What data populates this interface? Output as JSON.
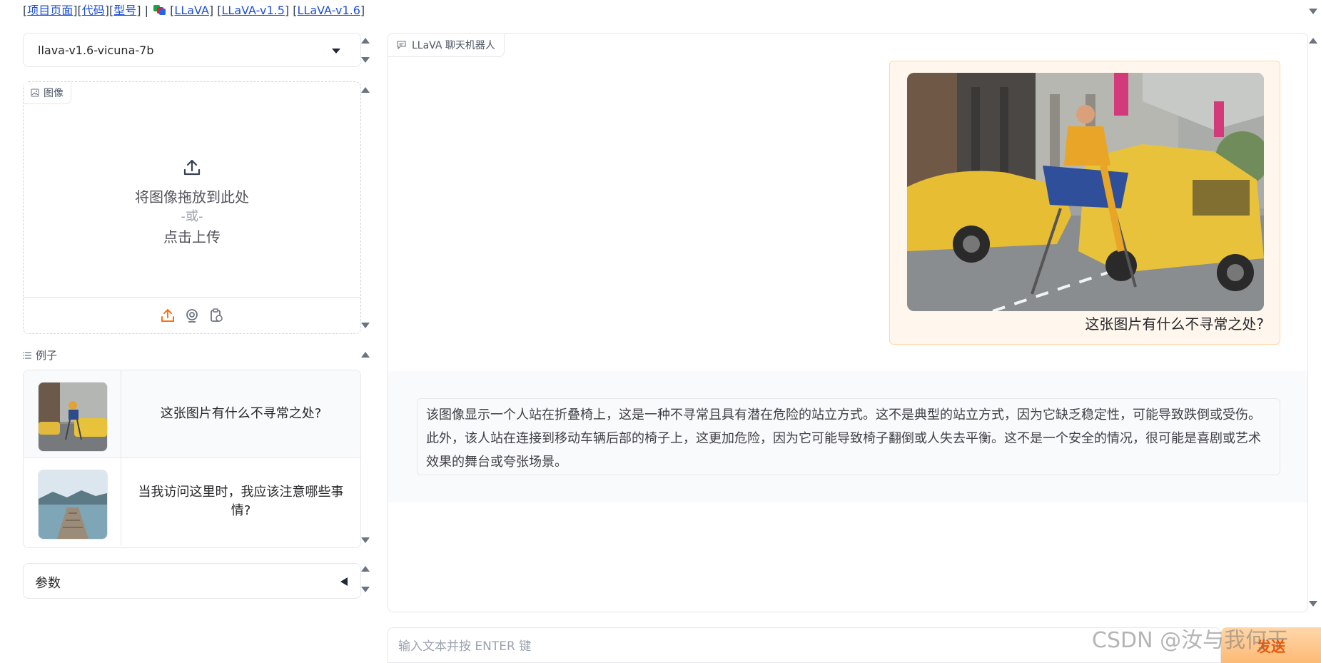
{
  "top_links": {
    "project_page": "项目页面",
    "code": "代码",
    "model": "型号",
    "divider": "|",
    "llava": "LLaVA",
    "llava_15": "LLaVA-v1.5",
    "llava_16": "LLaVA-v1.6"
  },
  "model_select": {
    "value": "llava-v1.6-vicuna-7b"
  },
  "image_panel": {
    "label": "图像",
    "drop_text": "将图像拖放到此处",
    "or_text": "-或-",
    "click_text": "点击上传"
  },
  "examples": {
    "label": "例子",
    "rows": [
      {
        "text": "这张图片有什么不寻常之处?"
      },
      {
        "text": "当我访问这里时，我应该注意哪些事情?"
      }
    ]
  },
  "params": {
    "label": "参数"
  },
  "chat": {
    "label": "LLaVA 聊天机器人",
    "user_message": "这张图片有什么不寻常之处?",
    "bot_message": "该图像显示一个人站在折叠椅上，这是一种不寻常且具有潜在危险的站立方式。这不是典型的站立方式，因为它缺乏稳定性，可能导致跌倒或受伤。此外，该人站在连接到移动车辆后部的椅子上，这更加危险，因为它可能导致椅子翻倒或人失去平衡。这不是一个安全的情况，很可能是喜剧或艺术效果的舞台或夸张场景。"
  },
  "input": {
    "placeholder": "输入文本并按 ENTER 键"
  },
  "send_button": {
    "label": "发送"
  },
  "watermark": "CSDN @汝与我何干",
  "colors": {
    "accent": "#f97316",
    "link": "#1d4ed8",
    "user_bubble": "#fff7ed"
  }
}
